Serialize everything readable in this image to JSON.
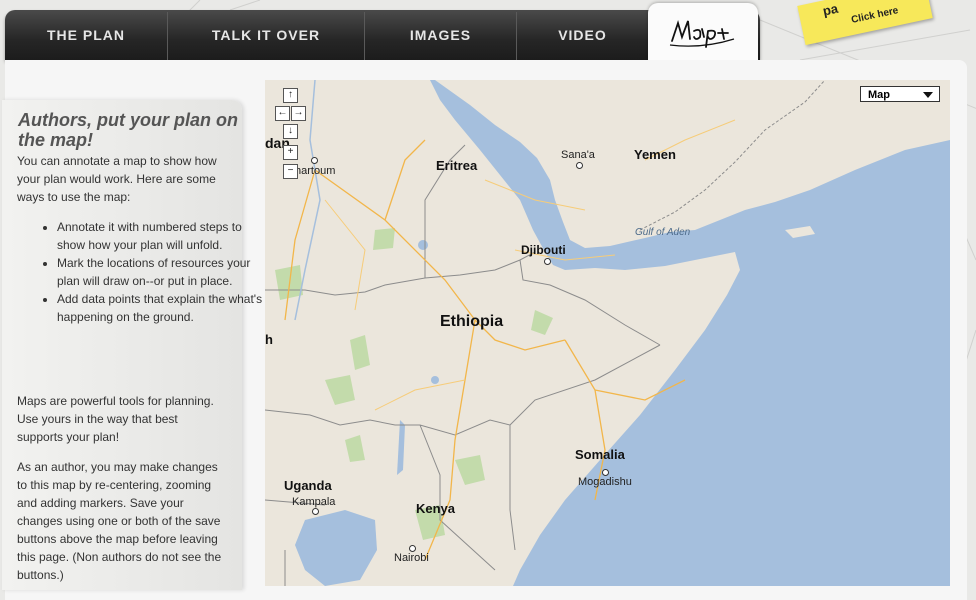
{
  "tabs": [
    "THE PLAN",
    "TALK IT OVER",
    "IMAGES",
    "VIDEO"
  ],
  "active_tab": "Map",
  "sticky": {
    "line1": "pa",
    "line2": "Click here"
  },
  "sidebar": {
    "title": "Authors, put your plan on the map!",
    "intro": "You can annotate a map to show how your plan would work. Here are some ways to use the map:",
    "bullets": [
      "Annotate it with numbered steps to show how your plan will unfold.",
      "Mark the locations of resources your plan will draw on--or put in place.",
      "Add data points that explain the what's happening on the ground."
    ],
    "para2": "Maps are powerful tools for planning. Use yours in the way that best supports your plan!",
    "para3": "As an author, you may make changes to this map by re-centering, zooming and adding markers. Save your changes using one or both of the save buttons above the map before leaving this page. (Non authors do not see the buttons.)"
  },
  "map": {
    "type_label": "Map",
    "controls": {
      "up": "↑",
      "left": "←",
      "right": "→",
      "down": "↓",
      "zoom_in": "+",
      "zoom_out": "−"
    },
    "labels": {
      "eritrea": "Eritrea",
      "yemen": "Yemen",
      "sanaa": "Sana'a",
      "djibouti": "Djibouti",
      "gulf_of_aden": "Gulf of Aden",
      "ethiopia": "Ethiopia",
      "somalia": "Somalia",
      "mogadishu": "Mogadishu",
      "uganda": "Uganda",
      "kampala": "Kampala",
      "kenya": "Kenya",
      "nairobi": "Nairobi",
      "khartoum": "hartoum",
      "dan": "dan",
      "h": "h"
    }
  }
}
